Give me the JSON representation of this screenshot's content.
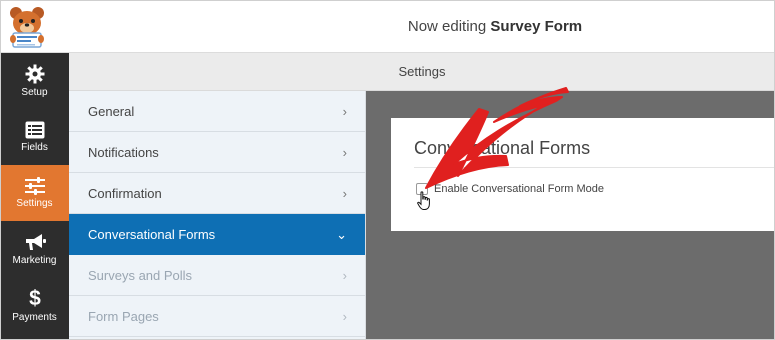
{
  "header": {
    "title_prefix": "Now editing",
    "form_name": "Survey Form"
  },
  "leftnav": {
    "items": [
      {
        "label": "Setup",
        "icon": "gear-icon"
      },
      {
        "label": "Fields",
        "icon": "fields-list-icon"
      },
      {
        "label": "Settings",
        "icon": "sliders-icon",
        "active": true
      },
      {
        "label": "Marketing",
        "icon": "megaphone-icon"
      },
      {
        "label": "Payments",
        "icon": "dollar-icon"
      }
    ]
  },
  "settings_bar": {
    "title": "Settings"
  },
  "subpanel": {
    "items": [
      {
        "label": "General",
        "chevron": "›"
      },
      {
        "label": "Notifications",
        "chevron": "›"
      },
      {
        "label": "Confirmation",
        "chevron": "›"
      },
      {
        "label": "Conversational Forms",
        "chevron": "⌄",
        "active": true
      },
      {
        "label": "Surveys and Polls",
        "chevron": "›",
        "disabled": true
      },
      {
        "label": "Form Pages",
        "chevron": "›",
        "disabled": true
      }
    ]
  },
  "card": {
    "title": "Conversational Forms",
    "checkbox_label": "Enable Conversational Form Mode",
    "checkbox_checked": false
  },
  "colors": {
    "accent_orange": "#e27730",
    "active_blue": "#0e6fb4",
    "annotation_red": "#e0201f"
  }
}
